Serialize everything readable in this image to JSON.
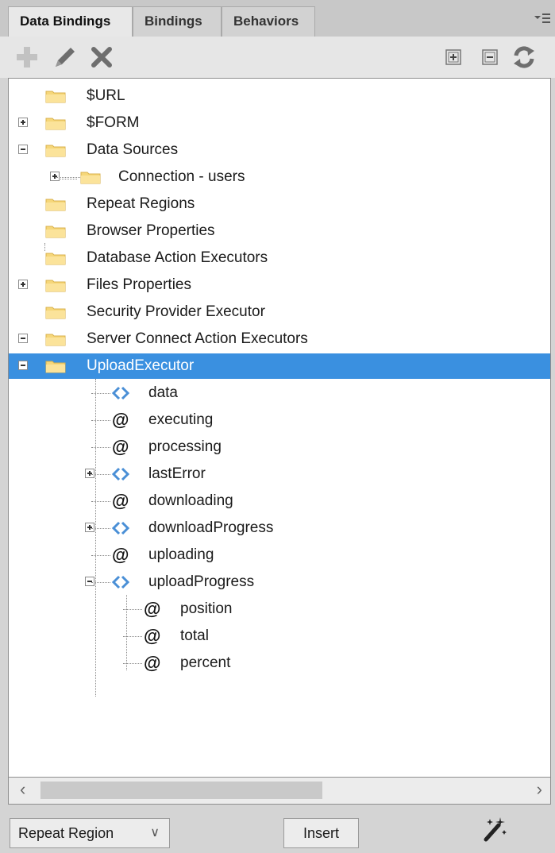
{
  "tabs": [
    {
      "label": "Data Bindings",
      "active": true
    },
    {
      "label": "Bindings",
      "active": false
    },
    {
      "label": "Behaviors",
      "active": false
    }
  ],
  "toolbar": {
    "add_icon": "plus-icon",
    "edit_icon": "pencil-icon",
    "delete_icon": "x-icon",
    "expand_all_icon": "expand-all-icon",
    "collapse_all_icon": "collapse-all-icon",
    "refresh_icon": "refresh-icon"
  },
  "tree": [
    {
      "label": "$URL",
      "icon": "folder-icon"
    },
    {
      "label": "$FORM",
      "icon": "folder-icon",
      "expander": "plus"
    },
    {
      "label": "Data Sources",
      "icon": "folder-icon",
      "expander": "minus"
    },
    {
      "label": "Connection - users",
      "icon": "folder-icon",
      "expander": "plus"
    },
    {
      "label": "Repeat Regions",
      "icon": "folder-icon"
    },
    {
      "label": "Browser Properties",
      "icon": "folder-icon"
    },
    {
      "label": "Database Action Executors",
      "icon": "folder-icon"
    },
    {
      "label": "Files Properties",
      "icon": "folder-icon",
      "expander": "plus"
    },
    {
      "label": "Security Provider Executor",
      "icon": "folder-icon"
    },
    {
      "label": "Server Connect Action Executors",
      "icon": "folder-icon",
      "expander": "minus"
    },
    {
      "label": "UploadExecutor",
      "icon": "folder-icon",
      "expander": "minus",
      "selected": true
    },
    {
      "label": "data",
      "icon": "object-icon"
    },
    {
      "label": "executing",
      "icon": "at-sign-icon"
    },
    {
      "label": "processing",
      "icon": "at-sign-icon"
    },
    {
      "label": "lastError",
      "icon": "object-icon",
      "expander": "plus"
    },
    {
      "label": "downloading",
      "icon": "at-sign-icon"
    },
    {
      "label": "downloadProgress",
      "icon": "object-icon",
      "expander": "plus"
    },
    {
      "label": "uploading",
      "icon": "at-sign-icon"
    },
    {
      "label": "uploadProgress",
      "icon": "object-icon",
      "expander": "minus"
    },
    {
      "label": "position",
      "icon": "at-sign-icon"
    },
    {
      "label": "total",
      "icon": "at-sign-icon"
    },
    {
      "label": "percent",
      "icon": "at-sign-icon"
    }
  ],
  "bottom": {
    "repeat_select_value": "Repeat Region",
    "insert_label": "Insert",
    "wand_icon": "magic-wand-icon"
  },
  "colors": {
    "selection": "#3a90e0",
    "folder": "#f6d77a",
    "object_icon": "#4a8fd6"
  }
}
